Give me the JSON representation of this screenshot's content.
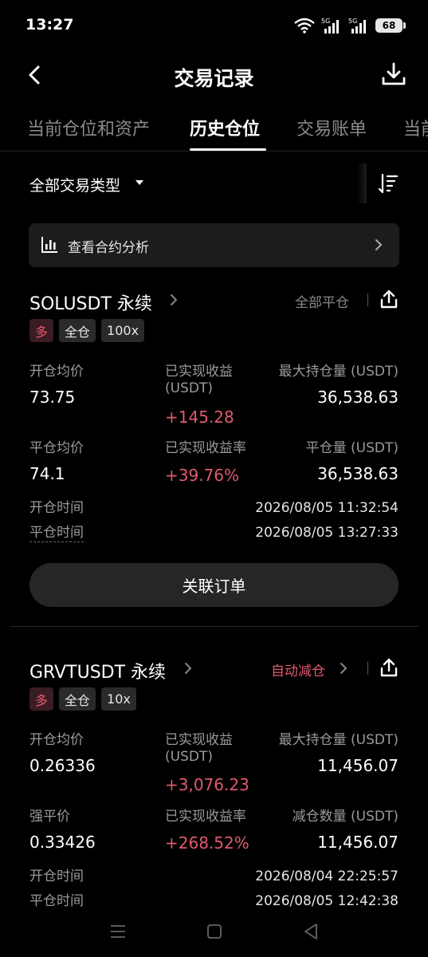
{
  "status": {
    "time": "13:27",
    "battery": "68",
    "sim1": "5G",
    "sim2": "5G"
  },
  "nav": {
    "title": "交易记录"
  },
  "tabs": [
    {
      "label": "当前仓位和资产"
    },
    {
      "label": "历史仓位"
    },
    {
      "label": "交易账单"
    },
    {
      "label": "当前委托"
    }
  ],
  "filter": {
    "label": "全部交易类型"
  },
  "analysis": {
    "label": "查看合约分析"
  },
  "positions": [
    {
      "symbol": "SOLUSDT 永续",
      "close_type": "全部平仓",
      "tags": [
        "多",
        "全仓",
        "100x"
      ],
      "open_avg_label": "开仓均价",
      "open_avg": "73.75",
      "pnl_label_1": "已实现收益",
      "pnl_label_2": "(USDT)",
      "pnl": "+145.28",
      "max_pos_label": "最大持仓量 (USDT)",
      "max_pos": "36,538.63",
      "row2_left_label": "平仓均价",
      "row2_left_value": "74.1",
      "pnl_rate_label": "已实现收益率",
      "pnl_rate": "+39.76%",
      "row2_right_label": "平仓量 (USDT)",
      "row2_right_value": "36,538.63",
      "open_time_label": "开仓时间",
      "open_time": "2026/08/05 11:32:54",
      "close_time_label": "平仓时间",
      "close_time": "2026/08/05 13:27:33",
      "button": "关联订单"
    },
    {
      "symbol": "GRVTUSDT 永续",
      "close_type": "自动减仓",
      "tags": [
        "多",
        "全仓",
        "10x"
      ],
      "open_avg_label": "开仓均价",
      "open_avg": "0.26336",
      "pnl_label_1": "已实现收益",
      "pnl_label_2": "(USDT)",
      "pnl": "+3,076.23",
      "max_pos_label": "最大持仓量 (USDT)",
      "max_pos": "11,456.07",
      "row2_left_label": "强平价",
      "row2_left_value": "0.33426",
      "pnl_rate_label": "已实现收益率",
      "pnl_rate": "+268.52%",
      "row2_right_label": "减仓数量 (USDT)",
      "row2_right_value": "11,456.07",
      "open_time_label": "开仓时间",
      "open_time": "2026/08/04 22:25:57",
      "close_time_label": "平仓时间",
      "close_time": "2026/08/05 12:42:38"
    }
  ],
  "colors": {
    "background": "#000000",
    "positive": "#e05a6e",
    "muted": "#9a9a9a",
    "card": "#1c1c1e"
  }
}
